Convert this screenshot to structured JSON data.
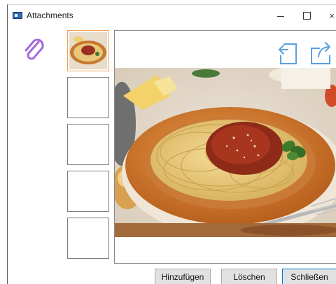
{
  "window": {
    "title": "Attachments",
    "controls": {
      "minimize": "–",
      "close": "×"
    }
  },
  "attachments": {
    "thumbnails": [
      {
        "state": "selected",
        "content": "spaghetti-image"
      },
      {
        "state": "empty"
      },
      {
        "state": "empty"
      },
      {
        "state": "empty"
      },
      {
        "state": "empty"
      }
    ]
  },
  "preview": {
    "image_subject": "Spaghetti bolognese plate"
  },
  "buttons": {
    "add": "Hinzufügen",
    "delete": "Löschen",
    "close": "Schließen"
  },
  "colors": {
    "clip_icon": "#a36bdc",
    "toolbar_icon": "#5aa0e0",
    "selected_thumb_border": "#f0a050",
    "default_button_border": "#0078d7"
  }
}
